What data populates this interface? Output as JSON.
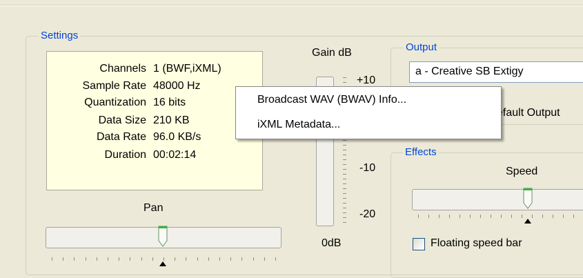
{
  "settings": {
    "title": "Settings",
    "info": [
      {
        "key": "Channels",
        "value": "1 (BWF,iXML)"
      },
      {
        "key": "Sample Rate",
        "value": "48000 Hz"
      },
      {
        "key": "Quantization",
        "value": "16 bits"
      },
      {
        "key": "Data Size",
        "value": "210 KB"
      },
      {
        "key": "Data Rate",
        "value": "96.0 KB/s"
      },
      {
        "key": "Duration",
        "value": "00:02:14"
      }
    ],
    "pan": {
      "label": "Pan",
      "position": 0.5
    }
  },
  "gain": {
    "label": "Gain dB",
    "ticks": [
      "+10",
      "-10",
      "-20"
    ],
    "bottom_label": "0dB"
  },
  "output": {
    "title": "Output",
    "device": "a  - Creative SB Extigy",
    "partial_button_text": "efault Output"
  },
  "effects": {
    "title": "Effects",
    "speed": {
      "label": "Speed",
      "position": 0.5
    },
    "floating_speed_bar": {
      "label": "Floating speed bar",
      "checked": false
    }
  },
  "context_menu": {
    "items": [
      {
        "label": "Broadcast WAV (BWAV) Info..."
      },
      {
        "label": "iXML Metadata..."
      }
    ]
  }
}
